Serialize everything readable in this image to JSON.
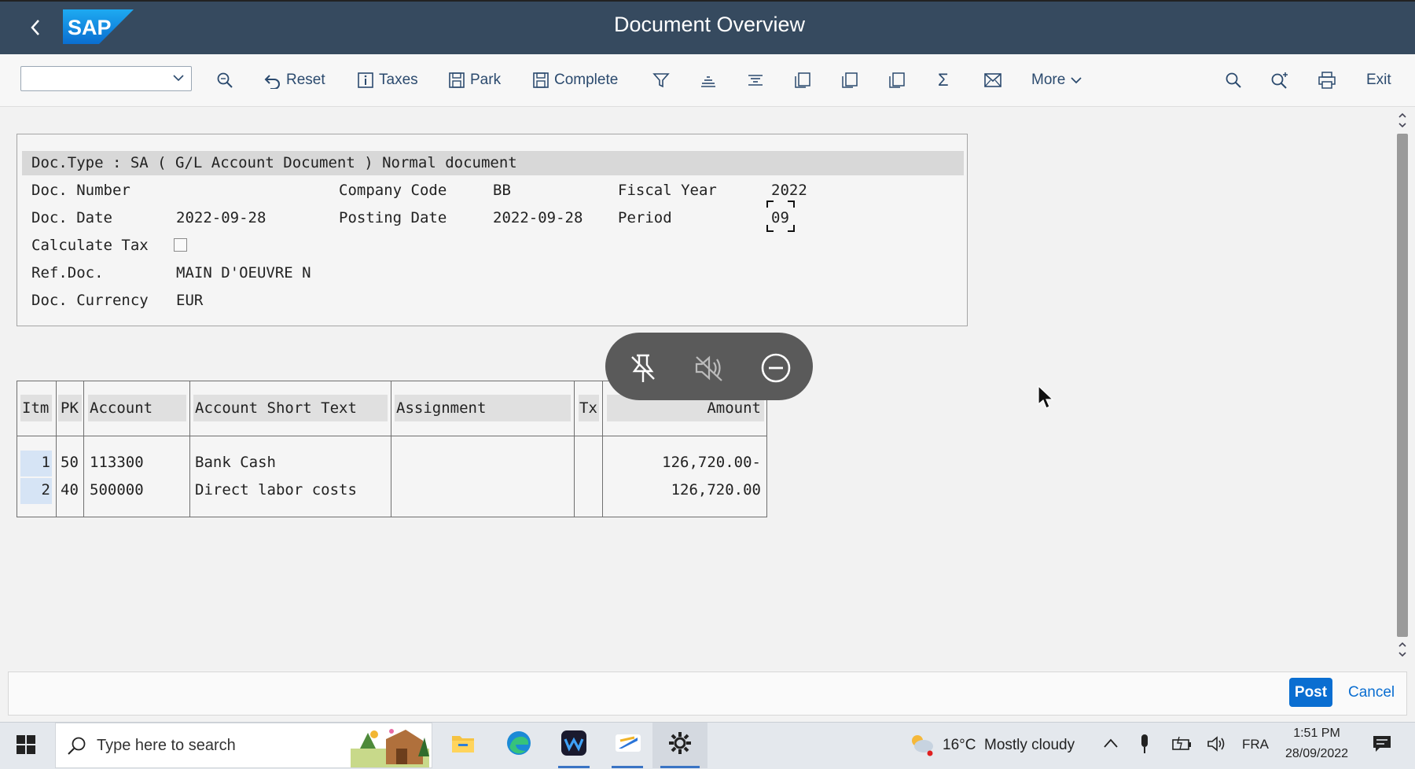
{
  "shell": {
    "back_glyph": "‹",
    "logo_text": "SAP",
    "title": "Document Overview"
  },
  "toolbar": {
    "command_value": "",
    "reset_label": "Reset",
    "taxes_label": "Taxes",
    "park_label": "Park",
    "complete_label": "Complete",
    "sum_glyph": "Σ",
    "more_label": "More",
    "exit_label": "Exit"
  },
  "doc_header": {
    "doc_type_line": "Doc.Type : SA ( G/L Account Document ) Normal document",
    "doc_number_label": "Doc. Number",
    "doc_number_value": "",
    "company_code_label": "Company Code",
    "company_code_value": "BB",
    "fiscal_year_label": "Fiscal Year",
    "fiscal_year_value": "2022",
    "doc_date_label": "Doc. Date",
    "doc_date_value": "2022-09-28",
    "posting_date_label": "Posting Date",
    "posting_date_value": "2022-09-28",
    "period_label": "Period",
    "period_value": "09",
    "calculate_tax_label": "Calculate Tax",
    "calculate_tax_checked": false,
    "ref_doc_label": "Ref.Doc.",
    "ref_doc_value": "MAIN D'OEUVRE N",
    "doc_currency_label": "Doc. Currency",
    "doc_currency_value": "EUR"
  },
  "items_table": {
    "columns": [
      "Itm",
      "PK",
      "Account",
      "Account Short Text",
      "Assignment",
      "Tx",
      "Amount"
    ],
    "rows": [
      {
        "itm": "1",
        "pk": "50",
        "account": "113300",
        "text": "Bank Cash",
        "assignment": "",
        "tx": "",
        "amount": "126,720.00-"
      },
      {
        "itm": "2",
        "pk": "40",
        "account": "500000",
        "text": "Direct labor costs",
        "assignment": "",
        "tx": "",
        "amount": "126,720.00"
      }
    ]
  },
  "footer": {
    "post_label": "Post",
    "cancel_label": "Cancel"
  },
  "taskbar": {
    "search_placeholder": "Type here to search",
    "weather_temp": "16°C",
    "weather_desc": "Mostly cloudy",
    "language": "FRA",
    "time": "1:51 PM",
    "date": "28/09/2022"
  },
  "colors": {
    "shell_bg": "#364a5f",
    "accent": "#0a6ed1",
    "toolbar_text": "#2b4a6e"
  }
}
